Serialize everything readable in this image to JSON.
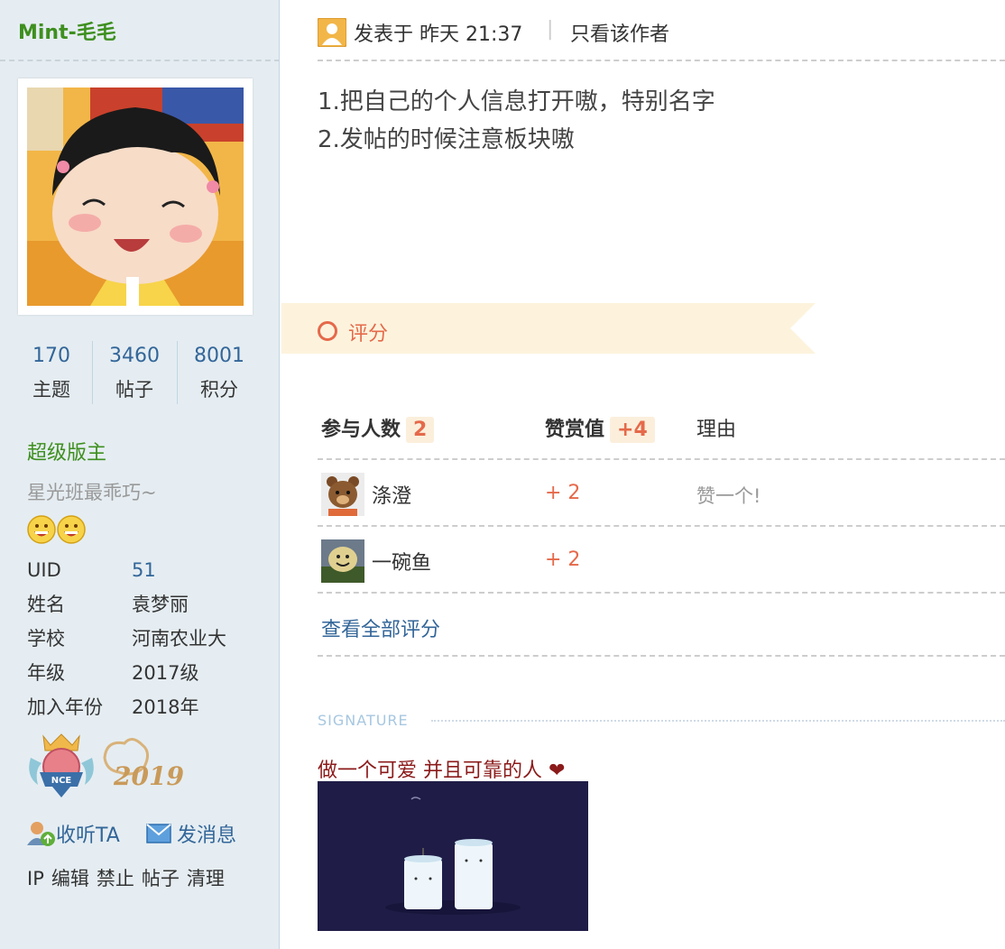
{
  "author": {
    "username": "Mint-毛毛",
    "stats": [
      {
        "value": "170",
        "label": "主题"
      },
      {
        "value": "3460",
        "label": "帖子"
      },
      {
        "value": "8001",
        "label": "积分"
      }
    ],
    "group": "超级版主",
    "motto": "星光班最乖巧~",
    "info": [
      {
        "key": "UID",
        "value": "51"
      },
      {
        "key": "姓名",
        "value": "袁梦丽"
      },
      {
        "key": "学校",
        "value": "河南农业大"
      },
      {
        "key": "年级",
        "value": "2017级"
      },
      {
        "key": "加入年份",
        "value": "2018年"
      }
    ],
    "medal_text": "2019",
    "medal_badge_text": "NCE",
    "follow_label": "收听TA",
    "message_label": "发消息",
    "admin_links": [
      "IP",
      "编辑",
      "禁止",
      "帖子",
      "清理"
    ]
  },
  "post": {
    "posted_at": "发表于 昨天 21:37",
    "separator": "|",
    "only_author_label": "只看该作者",
    "lines": [
      "1.把自己的个人信息打开嗷，特别名字",
      "2.发帖的时候注意板块嗷"
    ]
  },
  "rating": {
    "title": "评分",
    "participants_label": "参与人数",
    "participants_count": "2",
    "score_label": "赞赏值",
    "score_total": "+4",
    "reason_label": "理由",
    "rows": [
      {
        "name": "涤澄",
        "score": "+ 2",
        "reason": "赞一个!"
      },
      {
        "name": "一碗鱼",
        "score": "+ 2",
        "reason": ""
      }
    ],
    "view_all_label": "查看全部评分"
  },
  "signature": {
    "label": "SIGNATURE",
    "text": "做一个可爱 并且可靠的人 ❤"
  },
  "colors": {
    "sidebar_bg": "#e5edf2",
    "username_green": "#3e8f1f",
    "link_blue": "#336699",
    "rating_orange": "#e5694a",
    "banner_bg": "#fdf3dd",
    "signature_red": "#8b1a1a"
  }
}
